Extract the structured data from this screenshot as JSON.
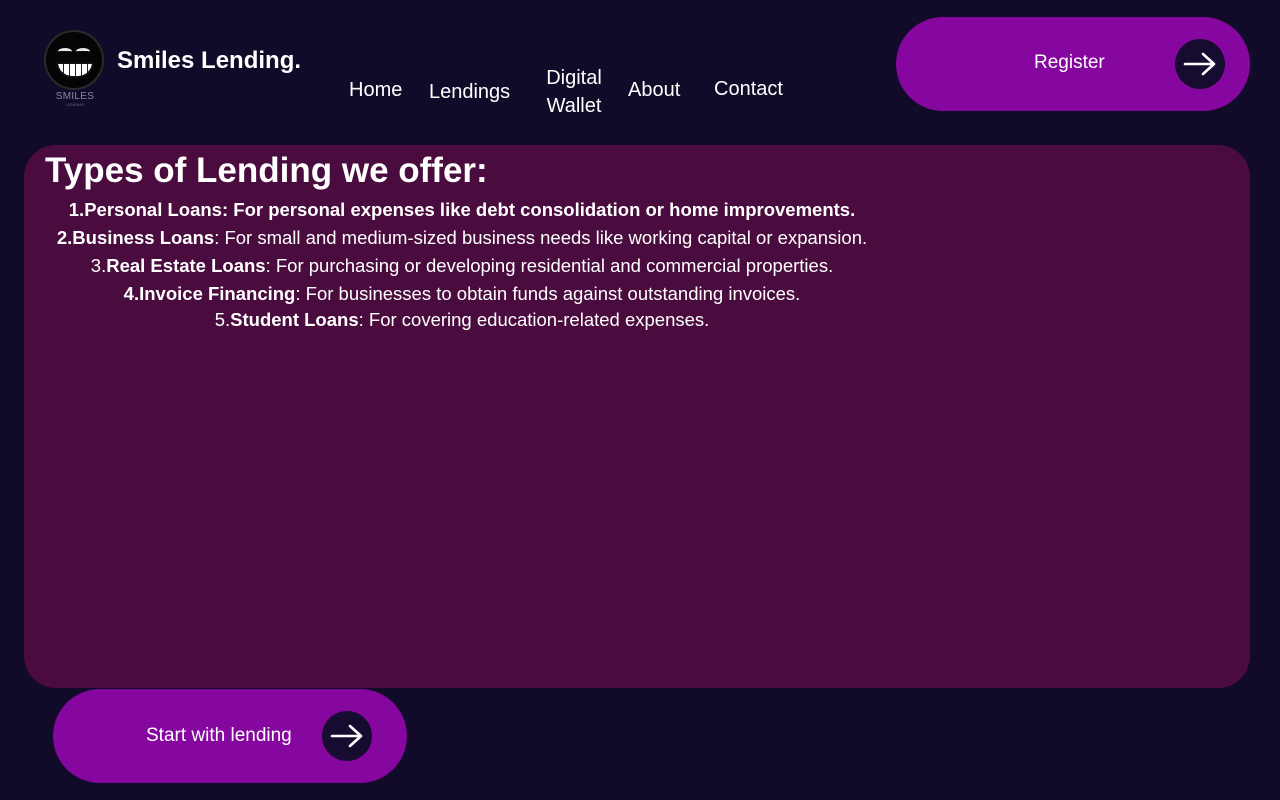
{
  "brand": {
    "logo_caption": "SMILES",
    "logo_subcaption": "LENDING",
    "name": "Smiles Lending."
  },
  "nav": {
    "home": "Home",
    "lendings": "Lendings",
    "digital_wallet": "Digital Wallet",
    "about": "About",
    "contact": "Contact"
  },
  "register_button": {
    "label": "Register",
    "icon": "arrow-right-icon"
  },
  "lending_panel": {
    "title": "Types of Lending we offer:",
    "items": [
      {
        "number": "1.",
        "name": "Personal Loans",
        "description": ": For personal expenses like debt consolidation or home improvements."
      },
      {
        "number": "2.",
        "name": "Business Loans",
        "description": ": For small and medium-sized business needs like working capital or expansion."
      },
      {
        "number": "3.",
        "name": "Real Estate Loans",
        "description": ": For purchasing or developing residential and commercial properties."
      },
      {
        "number": "4.",
        "name": "Invoice Financing",
        "description": ": For businesses to obtain funds against outstanding invoices."
      },
      {
        "number": "5.",
        "name": "Student Loans",
        "description": ": For covering education-related expenses."
      }
    ]
  },
  "start_button": {
    "label": "Start with lending",
    "icon": "arrow-right-icon"
  },
  "colors": {
    "background": "#110a28",
    "panel": "#4a0c3e",
    "button": "#86079f",
    "arrow_circle": "#170b30"
  }
}
